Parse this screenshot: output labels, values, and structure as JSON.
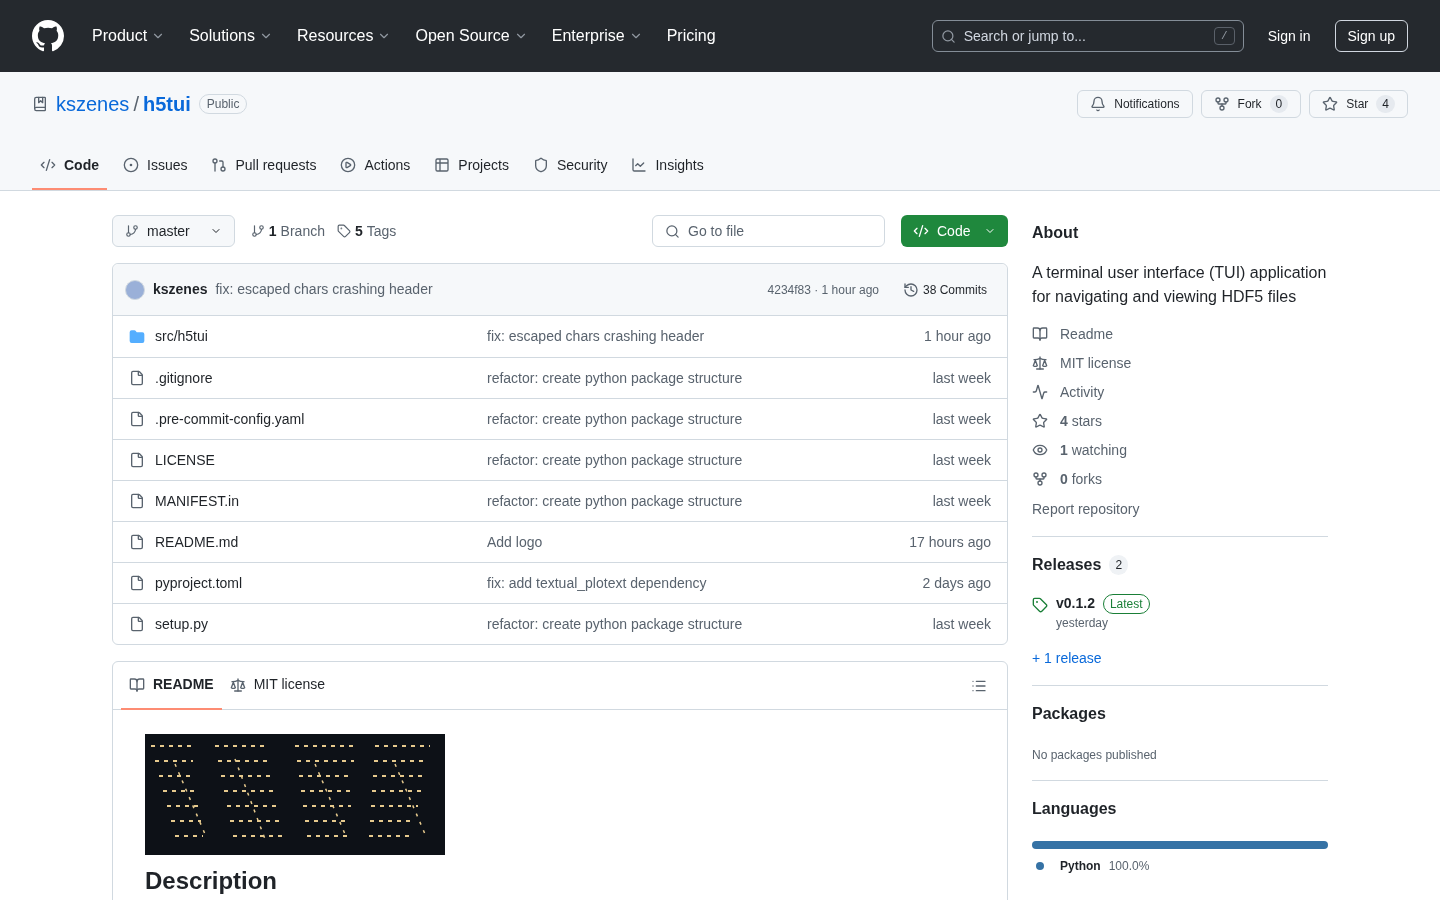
{
  "header": {
    "nav": [
      {
        "label": "Product",
        "dropdown": true
      },
      {
        "label": "Solutions",
        "dropdown": true
      },
      {
        "label": "Resources",
        "dropdown": true
      },
      {
        "label": "Open Source",
        "dropdown": true
      },
      {
        "label": "Enterprise",
        "dropdown": true
      },
      {
        "label": "Pricing",
        "dropdown": false
      }
    ],
    "search": {
      "placeholder": "Search or jump to...",
      "shortcut": "/"
    },
    "sign_in": "Sign in",
    "sign_up": "Sign up"
  },
  "repo": {
    "owner": "kszenes",
    "separator": "/",
    "name": "h5tui",
    "visibility": "Public",
    "actions": [
      {
        "kind": "notifications",
        "label": "Notifications"
      },
      {
        "kind": "fork",
        "label": "Fork",
        "count": "0"
      },
      {
        "kind": "star",
        "label": "Star",
        "count": "4"
      }
    ]
  },
  "tabs": [
    {
      "kind": "code",
      "label": "Code",
      "selected": true
    },
    {
      "kind": "issues",
      "label": "Issues",
      "selected": false
    },
    {
      "kind": "pulls",
      "label": "Pull requests",
      "selected": false
    },
    {
      "kind": "actions",
      "label": "Actions",
      "selected": false
    },
    {
      "kind": "projects",
      "label": "Projects",
      "selected": false
    },
    {
      "kind": "security",
      "label": "Security",
      "selected": false
    },
    {
      "kind": "insights",
      "label": "Insights",
      "selected": false
    }
  ],
  "toolbar": {
    "branch": "master",
    "branches_count": "1",
    "branches_label": "Branch",
    "tags_count": "5",
    "tags_label": "Tags",
    "go_to_file": "Go to file",
    "code_button": "Code"
  },
  "last_commit": {
    "author": "kszenes",
    "message": "fix: escaped chars crashing header",
    "meta": "4234f83 · 1 hour ago",
    "commits": "38 Commits"
  },
  "files": [
    {
      "kind": "folder",
      "name": "src/h5tui",
      "message": "fix: escaped chars crashing header",
      "time": "1 hour ago"
    },
    {
      "kind": "file",
      "name": ".gitignore",
      "message": "refactor: create python package structure",
      "time": "last week"
    },
    {
      "kind": "file",
      "name": ".pre-commit-config.yaml",
      "message": "refactor: create python package structure",
      "time": "last week"
    },
    {
      "kind": "file",
      "name": "LICENSE",
      "message": "refactor: create python package structure",
      "time": "last week"
    },
    {
      "kind": "file",
      "name": "MANIFEST.in",
      "message": "refactor: create python package structure",
      "time": "last week"
    },
    {
      "kind": "file",
      "name": "README.md",
      "message": "Add logo",
      "time": "17 hours ago"
    },
    {
      "kind": "file",
      "name": "pyproject.toml",
      "message": "fix: add textual_plotext dependency",
      "time": "2 days ago"
    },
    {
      "kind": "file",
      "name": "setup.py",
      "message": "refactor: create python package structure",
      "time": "last week"
    }
  ],
  "readme": {
    "tabs": [
      {
        "kind": "readme",
        "label": "README",
        "selected": true
      },
      {
        "kind": "license",
        "label": "MIT license",
        "selected": false
      }
    ],
    "heading": "Description"
  },
  "about": {
    "title": "About",
    "description": "A terminal user interface (TUI) application for navigating and viewing HDF5 files",
    "links": [
      {
        "kind": "readme",
        "label": "Readme"
      },
      {
        "kind": "license",
        "label": "MIT license"
      },
      {
        "kind": "activity",
        "label": "Activity"
      },
      {
        "kind": "stars",
        "count": "4",
        "label": "stars"
      },
      {
        "kind": "watching",
        "count": "1",
        "label": "watching"
      },
      {
        "kind": "forks",
        "count": "0",
        "label": "forks"
      }
    ],
    "report": "Report repository"
  },
  "releases": {
    "title": "Releases",
    "count": "2",
    "latest": {
      "version": "v0.1.2",
      "badge": "Latest",
      "date": "yesterday"
    },
    "more": "+ 1 release"
  },
  "packages": {
    "title": "Packages",
    "note": "No packages published"
  },
  "languages": {
    "title": "Languages",
    "items": [
      {
        "name": "Python",
        "percent": "100.0%",
        "level": 1,
        "color": "#3572a5"
      }
    ]
  }
}
